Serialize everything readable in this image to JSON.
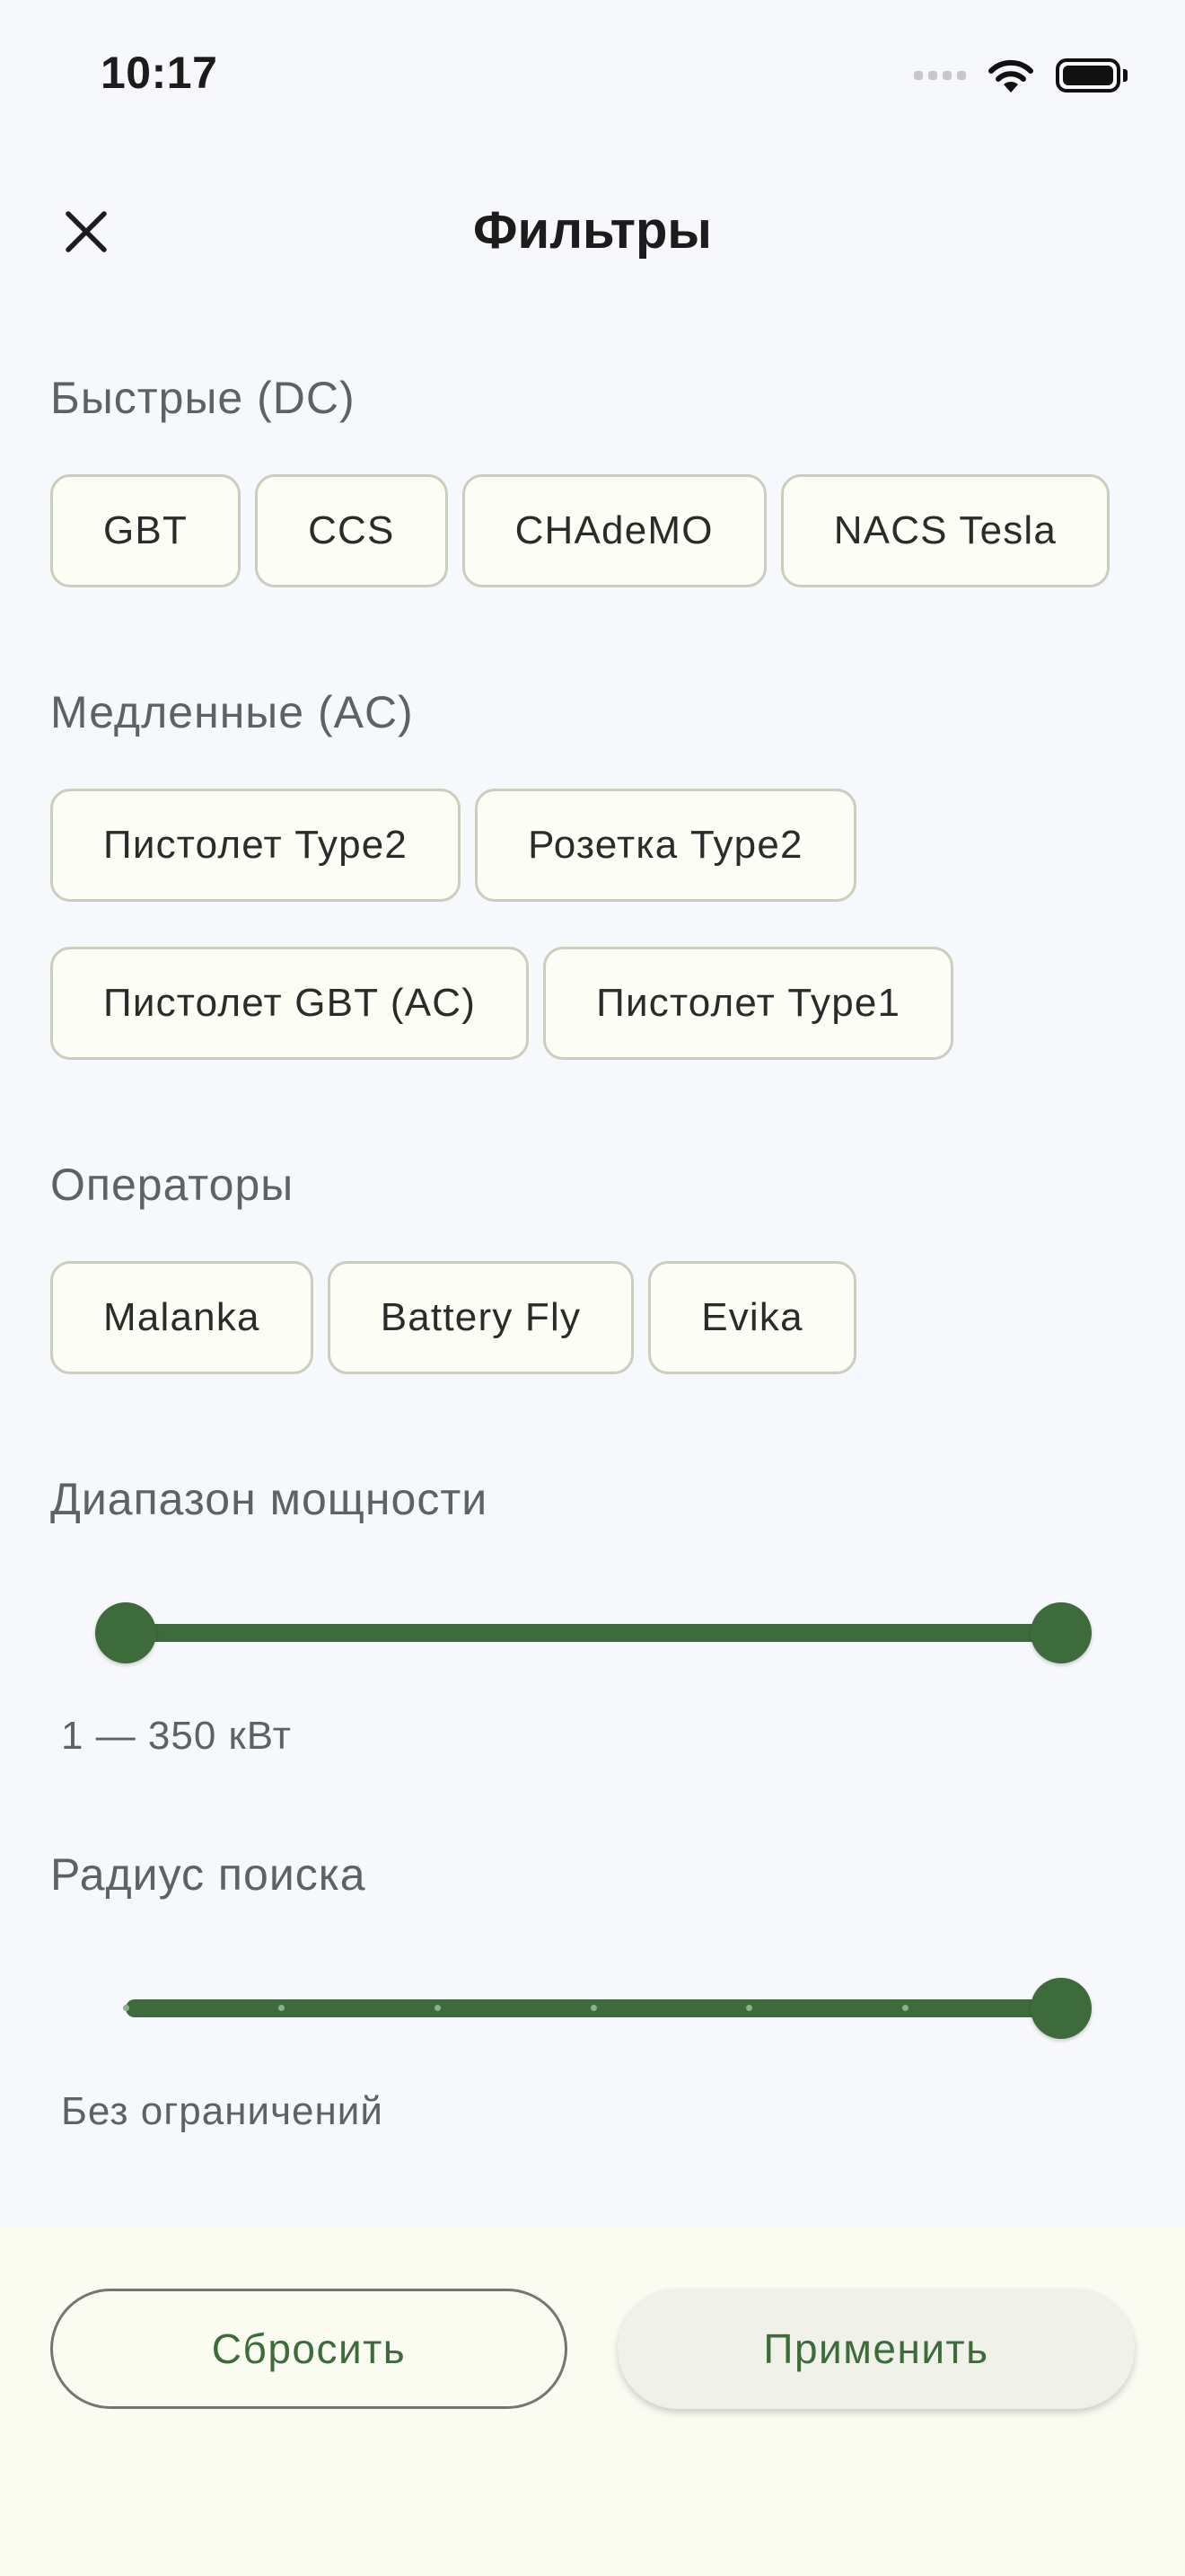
{
  "status_bar": {
    "time": "10:17"
  },
  "header": {
    "title": "Фильтры"
  },
  "sections": {
    "fast": {
      "label": "Быстрые (DC)",
      "chips": [
        "GBT",
        "CCS",
        "CHAdeMO",
        "NACS Tesla"
      ]
    },
    "slow": {
      "label": "Медленные (AC)",
      "row1": [
        "Пистолет Type2",
        "Розетка Type2"
      ],
      "row2": [
        "Пистолет GBT (AC)",
        "Пистолет Type1"
      ]
    },
    "operators": {
      "label": "Операторы",
      "chips": [
        "Malanka",
        "Battery Fly",
        "Evika"
      ]
    }
  },
  "power_range": {
    "label": "Диапазон мощности",
    "value_text": "1 — 350 кВт",
    "min_fraction": 0,
    "max_fraction": 1
  },
  "search_radius": {
    "label": "Радиус поиска",
    "value_text": "Без ограничений",
    "steps": 6,
    "value_step": 6
  },
  "actions": {
    "reset_label": "Сбросить",
    "apply_label": "Применить"
  },
  "colors": {
    "accent": "#3d6b3c",
    "chip_bg": "#fcfdf5",
    "chip_border": "#c9cfbf",
    "background": "#f7f8fb"
  },
  "icons": {
    "close": "close-icon",
    "signal": "cellular-signal-icon",
    "wifi": "wifi-icon",
    "battery": "battery-icon"
  }
}
